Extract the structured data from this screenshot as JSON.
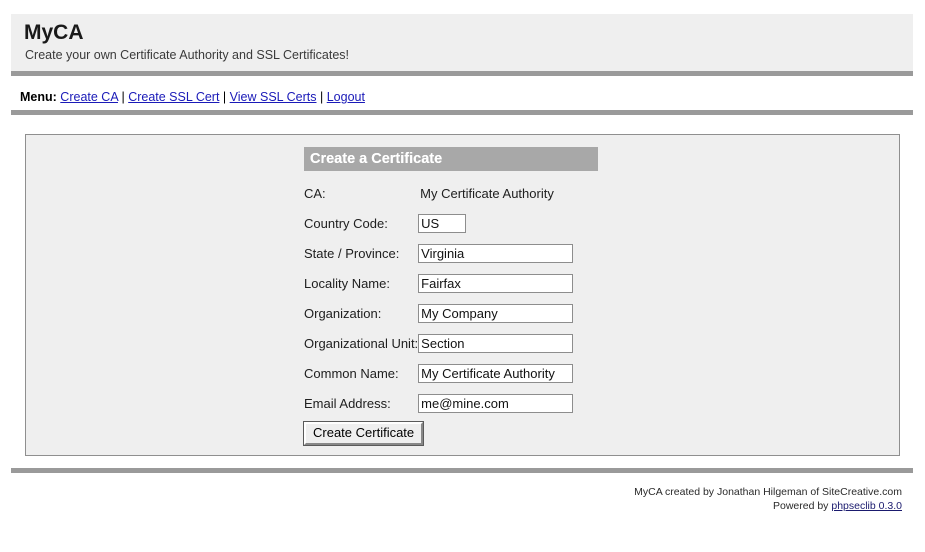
{
  "header": {
    "title": "MyCA",
    "subtitle": "Create your own Certificate Authority and SSL Certificates!"
  },
  "menu": {
    "label": "Menu:",
    "separator": "|",
    "items": [
      {
        "label": "Create CA"
      },
      {
        "label": "Create SSL Cert"
      },
      {
        "label": "View SSL Certs"
      },
      {
        "label": "Logout"
      }
    ]
  },
  "form": {
    "title": "Create a Certificate",
    "fields": [
      {
        "label": "CA:",
        "value": "My Certificate Authority",
        "type": "static"
      },
      {
        "label": "Country Code:",
        "value": "US",
        "type": "input",
        "width": "narrow"
      },
      {
        "label": "State / Province:",
        "value": "Virginia",
        "type": "input",
        "width": "wide"
      },
      {
        "label": "Locality Name:",
        "value": "Fairfax",
        "type": "input",
        "width": "wide"
      },
      {
        "label": "Organization:",
        "value": "My Company",
        "type": "input",
        "width": "wide"
      },
      {
        "label": "Organizational Unit:",
        "value": "Section",
        "type": "input",
        "width": "wide"
      },
      {
        "label": "Common Name:",
        "value": "My Certificate Authority",
        "type": "input",
        "width": "wide"
      },
      {
        "label": "Email Address:",
        "value": "me@mine.com",
        "type": "input",
        "width": "wide"
      }
    ],
    "submit_label": "Create Certificate"
  },
  "footer": {
    "line1": "MyCA created by Jonathan Hilgeman of SiteCreative.com",
    "line2_prefix": "Powered by ",
    "line2_link": "phpseclib 0.3.0"
  },
  "colors": {
    "panel_bg": "#efefef",
    "rule": "#9a9a9a",
    "title_bar": "#a8a8a8",
    "link": "#1a1ab8",
    "footer_link": "#1a1a6e"
  }
}
